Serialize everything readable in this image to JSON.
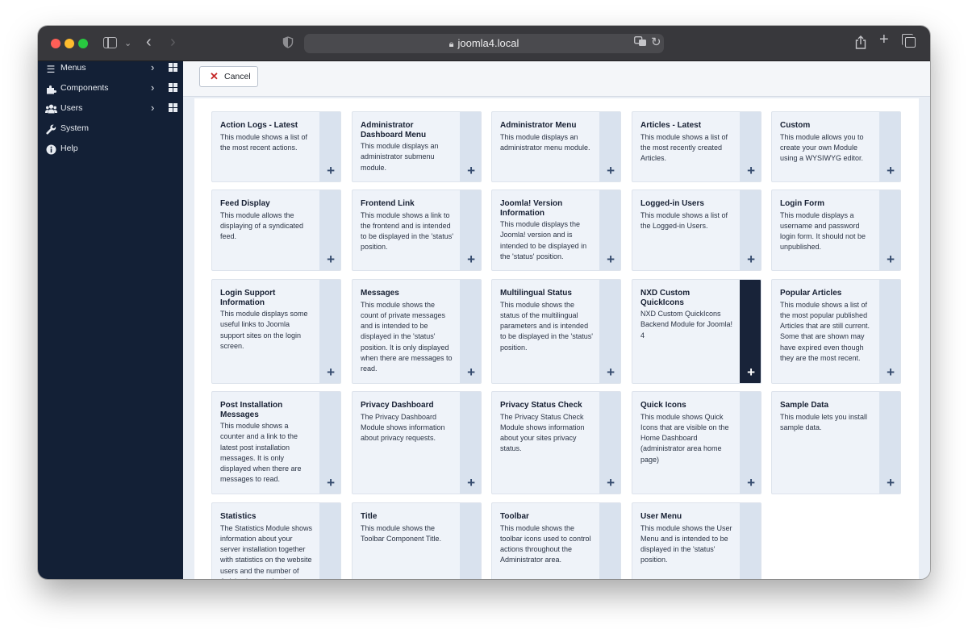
{
  "browser": {
    "url": "joomla4.local"
  },
  "sidebar": {
    "items": [
      {
        "label": "Menus",
        "icon": "list-icon"
      },
      {
        "label": "Components",
        "icon": "puzzle-icon"
      },
      {
        "label": "Users",
        "icon": "users-icon"
      },
      {
        "label": "System",
        "icon": "wrench-icon"
      },
      {
        "label": "Help",
        "icon": "info-icon"
      }
    ]
  },
  "toolbar": {
    "cancel_label": "Cancel"
  },
  "colors": {
    "sidebar_bg": "#132036",
    "card_bg": "#eff3f9",
    "card_side": "#d9e2ee",
    "active_side": "#182339",
    "cancel_icon": "#c52827"
  },
  "modules": [
    {
      "title": "Action Logs - Latest",
      "desc": "This module shows a list of the most recent actions."
    },
    {
      "title": "Administrator Dashboard Menu",
      "desc": "This module displays an administrator submenu module."
    },
    {
      "title": "Administrator Menu",
      "desc": "This module displays an administrator menu module."
    },
    {
      "title": "Articles - Latest",
      "desc": "This module shows a list of the most recently created Articles."
    },
    {
      "title": "Custom",
      "desc": "This module allows you to create your own Module using a WYSIWYG editor."
    },
    {
      "title": "Feed Display",
      "desc": "This module allows the displaying of a syndicated feed."
    },
    {
      "title": "Frontend Link",
      "desc": "This module shows a link to the frontend and is intended to be displayed in the 'status' position."
    },
    {
      "title": "Joomla! Version Information",
      "desc": "This module displays the Joomla! version and is intended to be displayed in the 'status' position."
    },
    {
      "title": "Logged-in Users",
      "desc": "This module shows a list of the Logged-in Users."
    },
    {
      "title": "Login Form",
      "desc": "This module displays a username and password login form. It should not be unpublished."
    },
    {
      "title": "Login Support Information",
      "desc": "This module displays some useful links to Joomla support sites on the login screen."
    },
    {
      "title": "Messages",
      "desc": "This module shows the count of private messages and is intended to be displayed in the 'status' position. It is only displayed when there are messages to read."
    },
    {
      "title": "Multilingual Status",
      "desc": "This module shows the status of the multilingual parameters and is intended to be displayed in the 'status' position."
    },
    {
      "title": "NXD Custom QuickIcons",
      "desc": "NXD Custom QuickIcons Backend Module for Joomla! 4"
    },
    {
      "title": "Popular Articles",
      "desc": "This module shows a list of the most popular published Articles that are still current. Some that are shown may have expired even though they are the most recent."
    },
    {
      "title": "Post Installation Messages",
      "desc": "This module shows a counter and a link to the latest post installation messages. It is only displayed when there are messages to read."
    },
    {
      "title": "Privacy Dashboard",
      "desc": "The Privacy Dashboard Module shows information about privacy requests."
    },
    {
      "title": "Privacy Status Check",
      "desc": "The Privacy Status Check Module shows information about your sites privacy status."
    },
    {
      "title": "Quick Icons",
      "desc": "This module shows Quick Icons that are visible on the Home Dashboard (administrator area home page)"
    },
    {
      "title": "Sample Data",
      "desc": "This module lets you install sample data."
    },
    {
      "title": "Statistics",
      "desc": "The Statistics Module shows information about your server installation together with statistics on the website users and the number of Articles in your database."
    },
    {
      "title": "Title",
      "desc": "This module shows the Toolbar Component Title."
    },
    {
      "title": "Toolbar",
      "desc": "This module shows the toolbar icons used to control actions throughout the Administrator area."
    },
    {
      "title": "User Menu",
      "desc": "This module shows the User Menu and is intended to be displayed in the 'status' position."
    }
  ]
}
